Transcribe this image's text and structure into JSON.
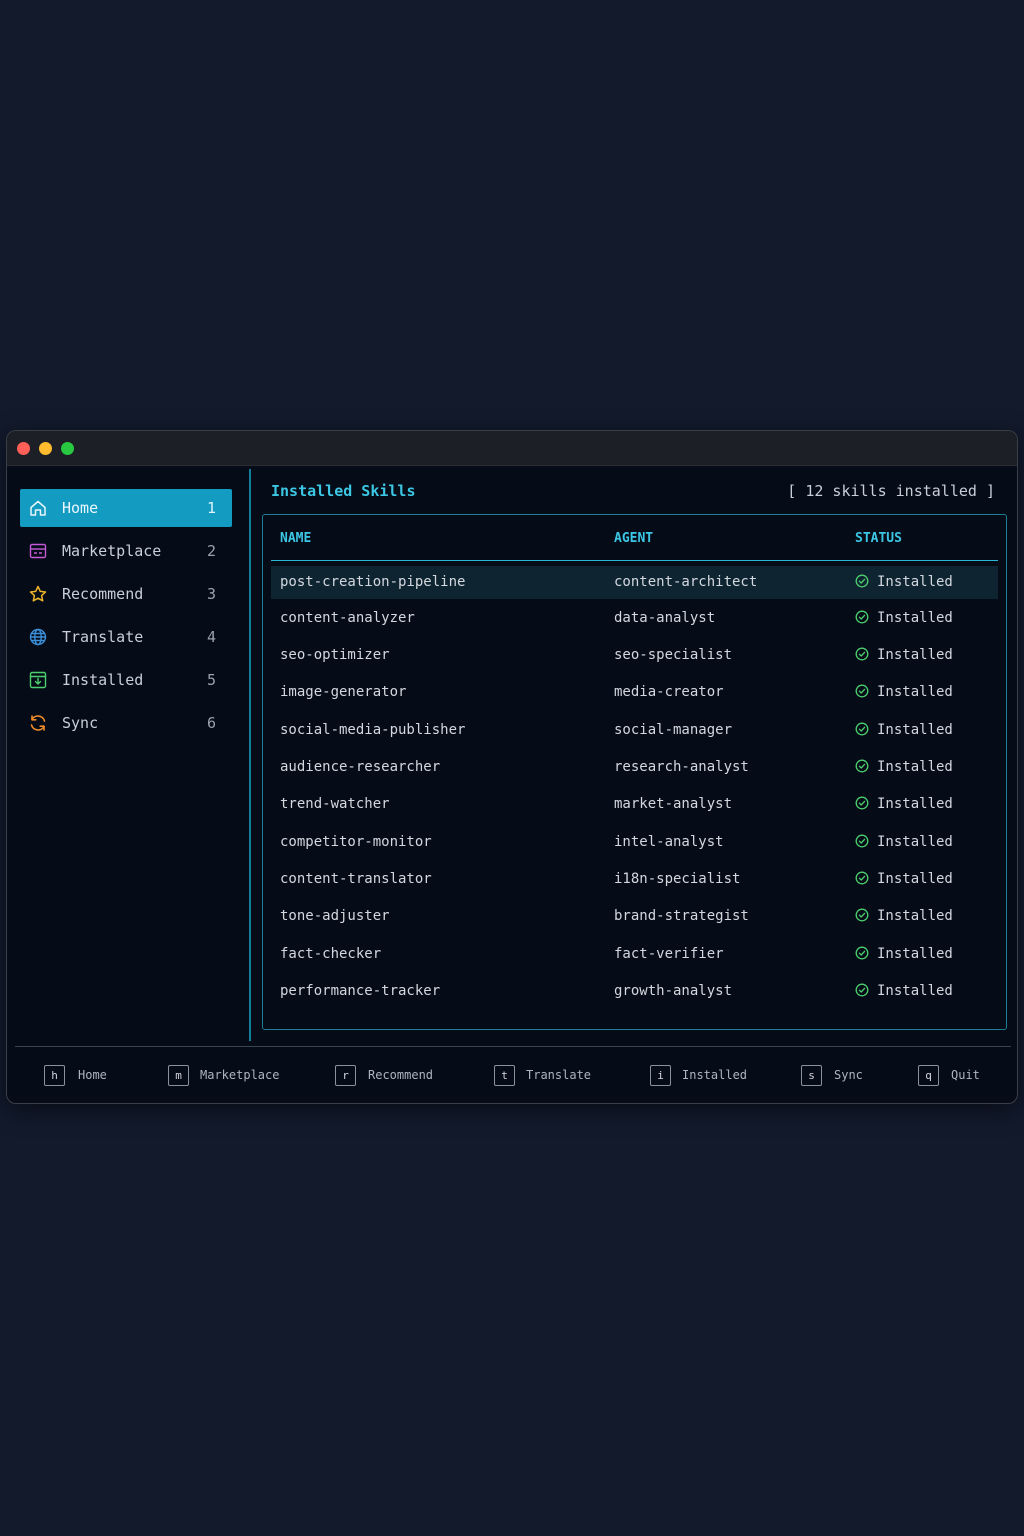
{
  "window": {
    "controls": [
      "close",
      "minimize",
      "maximize"
    ]
  },
  "sidebar": {
    "items": [
      {
        "label": "Home",
        "shortcut": "1",
        "icon": "home-icon",
        "active": true
      },
      {
        "label": "Marketplace",
        "shortcut": "2",
        "icon": "store-icon",
        "active": false
      },
      {
        "label": "Recommend",
        "shortcut": "3",
        "icon": "star-icon",
        "active": false
      },
      {
        "label": "Translate",
        "shortcut": "4",
        "icon": "globe-icon",
        "active": false
      },
      {
        "label": "Installed",
        "shortcut": "5",
        "icon": "download-box-icon",
        "active": false
      },
      {
        "label": "Sync",
        "shortcut": "6",
        "icon": "sync-icon",
        "active": false
      }
    ]
  },
  "main": {
    "title": "Installed Skills",
    "count_text": "[ 12 skills installed ]",
    "table": {
      "columns": [
        "NAME",
        "AGENT",
        "STATUS"
      ],
      "rows": [
        {
          "name": "post-creation-pipeline",
          "agent": "content-architect",
          "status": "Installed"
        },
        {
          "name": "content-analyzer",
          "agent": "data-analyst",
          "status": "Installed"
        },
        {
          "name": "seo-optimizer",
          "agent": "seo-specialist",
          "status": "Installed"
        },
        {
          "name": "image-generator",
          "agent": "media-creator",
          "status": "Installed"
        },
        {
          "name": "social-media-publisher",
          "agent": "social-manager",
          "status": "Installed"
        },
        {
          "name": "audience-researcher",
          "agent": "research-analyst",
          "status": "Installed"
        },
        {
          "name": "trend-watcher",
          "agent": "market-analyst",
          "status": "Installed"
        },
        {
          "name": "competitor-monitor",
          "agent": "intel-analyst",
          "status": "Installed"
        },
        {
          "name": "content-translator",
          "agent": "i18n-specialist",
          "status": "Installed"
        },
        {
          "name": "tone-adjuster",
          "agent": "brand-strategist",
          "status": "Installed"
        },
        {
          "name": "fact-checker",
          "agent": "fact-verifier",
          "status": "Installed"
        },
        {
          "name": "performance-tracker",
          "agent": "growth-analyst",
          "status": "Installed"
        }
      ]
    }
  },
  "footer": {
    "shortcuts": [
      {
        "key": "h",
        "label": "Home"
      },
      {
        "key": "m",
        "label": "Marketplace"
      },
      {
        "key": "r",
        "label": "Recommend"
      },
      {
        "key": "t",
        "label": "Translate"
      },
      {
        "key": "i",
        "label": "Installed"
      },
      {
        "key": "s",
        "label": "Sync"
      },
      {
        "key": "q",
        "label": "Quit"
      }
    ]
  },
  "colors": {
    "accent": "#3cc7e4",
    "active_bg": "#139bc1",
    "status_ok": "#4ccf6e",
    "background": "#050b17",
    "page_bg": "#121a2c"
  }
}
